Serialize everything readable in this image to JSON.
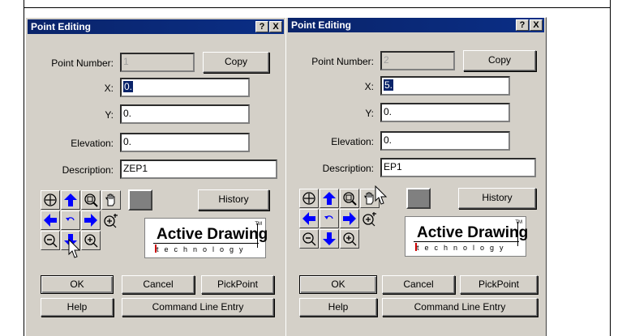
{
  "dialogs": [
    {
      "title": "Point Editing",
      "help_btn": "?",
      "close_btn": "X",
      "point_number_label": "Point Number:",
      "point_number_value": "1",
      "copy_label": "Copy",
      "x_label": "X:",
      "x_value": "0.",
      "y_label": "Y:",
      "y_value": "0.",
      "elevation_label": "Elevation:",
      "elevation_value": "0.",
      "description_label": "Description:",
      "description_value": "ZEP1",
      "history_label": "History",
      "logo_main": "Active Drawing",
      "logo_sub": "technology",
      "logo_tm": "TM",
      "ok_label": "OK",
      "cancel_label": "Cancel",
      "pickpoint_label": "PickPoint",
      "help_label": "Help",
      "cmdline_label": "Command Line Entry"
    },
    {
      "title": "Point Editing",
      "help_btn": "?",
      "close_btn": "X",
      "point_number_label": "Point Number:",
      "point_number_value": "2",
      "copy_label": "Copy",
      "x_label": "X:",
      "x_value": "5.",
      "y_label": "Y:",
      "y_value": "0.",
      "elevation_label": "Elevation:",
      "elevation_value": "0.",
      "description_label": "Description:",
      "description_value": "EP1",
      "history_label": "History",
      "logo_main": "Active Drawing",
      "logo_sub": "technology",
      "logo_tm": "TM",
      "ok_label": "OK",
      "cancel_label": "Cancel",
      "pickpoint_label": "PickPoint",
      "help_label": "Help",
      "cmdline_label": "Command Line Entry"
    }
  ],
  "colors": {
    "titlebar": "#0a246a",
    "dialog_bg": "#d4d0c8",
    "arrow_blue": "#0000ff",
    "swatch": "#808080"
  },
  "icons": [
    "zoom-extents-icon",
    "pan-up-icon",
    "zoom-window-icon",
    "pan-hand-icon",
    "pan-left-icon",
    "undo-view-icon",
    "pan-right-icon",
    "zoom-in-plus-icon",
    "zoom-out-icon",
    "pan-down-icon",
    "zoom-in-icon"
  ]
}
